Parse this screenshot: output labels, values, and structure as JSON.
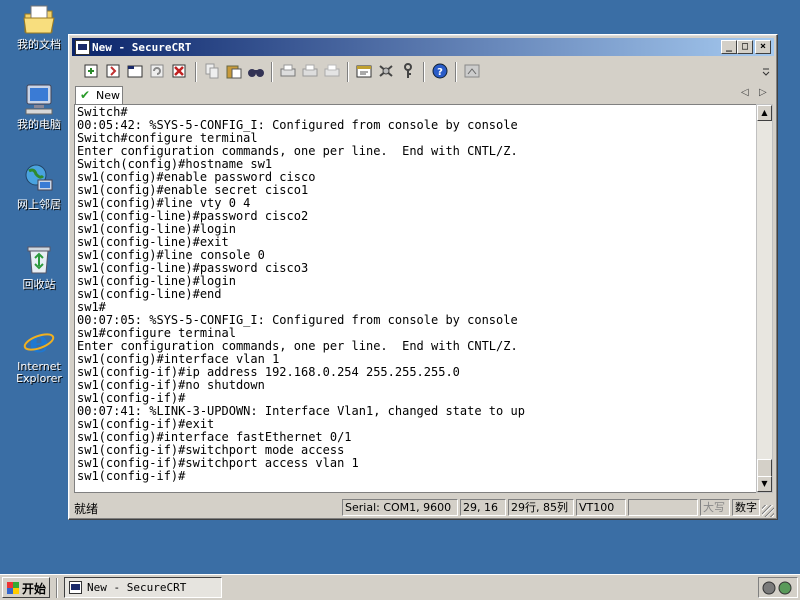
{
  "desktop": {
    "icons": [
      {
        "label": "我的文档",
        "icon": "my-documents-icon"
      },
      {
        "label": "我的电脑",
        "icon": "my-computer-icon"
      },
      {
        "label": "网上邻居",
        "icon": "network-places-icon"
      },
      {
        "label": "回收站",
        "icon": "recycle-bin-icon"
      },
      {
        "label": "Internet Explorer",
        "icon": "internet-explorer-icon"
      }
    ]
  },
  "window": {
    "title": "New - SecureCRT",
    "controls": {
      "minimize": "_",
      "maximize": "□",
      "close": "×"
    }
  },
  "tab": {
    "label": "New"
  },
  "terminal": {
    "lines": [
      "Switch#",
      "00:05:42: %SYS-5-CONFIG_I: Configured from console by console",
      "Switch#configure terminal",
      "Enter configuration commands, one per line.  End with CNTL/Z.",
      "Switch(config)#hostname sw1",
      "sw1(config)#enable password cisco",
      "sw1(config)#enable secret cisco1",
      "sw1(config)#line vty 0 4",
      "sw1(config-line)#password cisco2",
      "sw1(config-line)#login",
      "sw1(config-line)#exit",
      "sw1(config)#line console 0",
      "sw1(config-line)#password cisco3",
      "sw1(config-line)#login",
      "sw1(config-line)#end",
      "sw1#",
      "00:07:05: %SYS-5-CONFIG_I: Configured from console by console",
      "sw1#configure terminal",
      "Enter configuration commands, one per line.  End with CNTL/Z.",
      "sw1(config)#interface vlan 1",
      "sw1(config-if)#ip address 192.168.0.254 255.255.255.0",
      "sw1(config-if)#no shutdown",
      "sw1(config-if)#",
      "00:07:41: %LINK-3-UPDOWN: Interface Vlan1, changed state to up",
      "sw1(config-if)#exit",
      "sw1(config)#interface fastEthernet 0/1",
      "sw1(config-if)#switchport mode access",
      "sw1(config-if)#switchport access vlan 1",
      "sw1(config-if)#"
    ]
  },
  "statusbar": {
    "ready": "就绪",
    "serial": "Serial: COM1, 9600",
    "cursor": "29, 16",
    "size": "29行, 85列",
    "emulation": "VT100",
    "caps": "大写",
    "num": "数字"
  },
  "taskbar": {
    "start": "开始",
    "task": "New - SecureCRT"
  },
  "colors": {
    "desktop": "#3a6ea5",
    "titlebar": "#0a246a",
    "chrome": "#d4d0c8"
  }
}
